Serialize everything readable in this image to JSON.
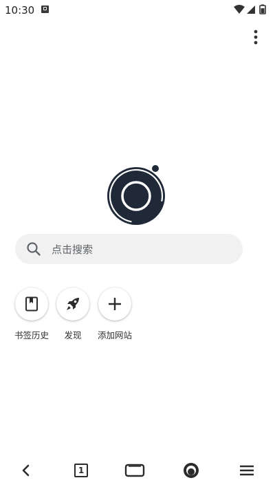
{
  "status_bar": {
    "time": "10:30",
    "icons": [
      "notification-icon",
      "wifi-icon",
      "signal-icon",
      "battery-icon"
    ]
  },
  "toolbar": {
    "menu_icon": "more-vert-icon"
  },
  "search": {
    "placeholder": "点击搜索",
    "icon": "search-icon"
  },
  "shortcuts": [
    {
      "label": "书签历史",
      "icon": "bookmark-icon"
    },
    {
      "label": "发现",
      "icon": "rocket-icon"
    },
    {
      "label": "添加网站",
      "icon": "plus-icon"
    }
  ],
  "bottom_nav": {
    "back_icon": "back-icon",
    "tab_count": "1",
    "items": [
      "back-icon",
      "tab-count-icon",
      "window-icon",
      "home-logo-icon",
      "menu-icon"
    ]
  },
  "colors": {
    "accent": "#1f2937",
    "search_bg": "#f1f1f1"
  }
}
